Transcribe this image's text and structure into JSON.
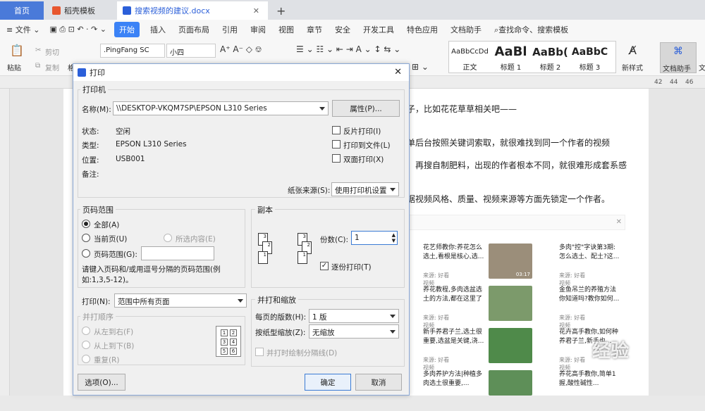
{
  "tabs": {
    "home": "首页",
    "dk": "稻壳模板",
    "doc": "搜索视频的建议.docx",
    "add": "+"
  },
  "menu": {
    "file": "文件",
    "start": "开始",
    "items": [
      "插入",
      "页面布局",
      "引用",
      "审阅",
      "视图",
      "章节",
      "安全",
      "开发工具",
      "特色应用",
      "文档助手"
    ],
    "search": "查找命令、搜索模板"
  },
  "ribbon": {
    "cut": "剪切",
    "copy": "复制",
    "paste": "粘贴",
    "painter": "格",
    "font": ".PingFang SC",
    "size": "小四",
    "styles": [
      {
        "sample": "AaBbCcDd",
        "name": "正文"
      },
      {
        "sample": "AaBl",
        "name": "标题 1"
      },
      {
        "sample": "AaBb(",
        "name": "标题 2"
      },
      {
        "sample": "AaBbC",
        "name": "标题 3"
      }
    ],
    "new_style": "新样式",
    "assistant": "文档助手",
    "wen": "文"
  },
  "ruler": [
    "42",
    "44",
    "46"
  ],
  "doc": {
    "lines": [
      "子，比如花花草草相关吧——",
      "单后台按照关键词索取，就很难找到同一个作者的视频",
      "、再搜自制肥料，出现的作者根本不同，就很难形成套系感",
      "据视频风格、质量、视频来源等方面先锁定一个作者。"
    ],
    "videos": [
      {
        "title": "花艺师教你:养花怎么选土,看根是核心,选...",
        "src": "来源: 好看视频"
      },
      {
        "title": "多肉\"控\"字诀第3期:怎么选土、配土?这...",
        "src": "来源: 好看视频"
      },
      {
        "title": "养花教程,多肉选盆选土的方法,都在这里了",
        "src": "来源: 好看视频"
      },
      {
        "title": "金鱼吊兰的养殖方法你知道吗?教你如何...",
        "src": "来源: 好看视频"
      },
      {
        "title": "新手养君子兰,选土很重要,选盆是关键,浇...",
        "src": "来源: 好看视频"
      },
      {
        "title": "花卉高手教你,如何种养君子兰,新手也...",
        "src": "来源: 好看视频"
      },
      {
        "title": "多肉养护方法|种植多肉选土很重要,...",
        "src": ""
      },
      {
        "title": "养花高手教你,简单1握,酸性碱性...",
        "src": ""
      }
    ],
    "durations": [
      "03:17"
    ],
    "watermark": "经验"
  },
  "dialog": {
    "title": "打印",
    "printer_group": "打印机",
    "name_label": "名称(M):",
    "printer": "\\\\DESKTOP-VKQM7SP\\EPSON L310 Series",
    "props": "属性(P)...",
    "status_label": "状态:",
    "status": "空闲",
    "type_label": "类型:",
    "type": "EPSON L310 Series",
    "where_label": "位置:",
    "where": "USB001",
    "comment_label": "备注:",
    "reverse": "反片打印(I)",
    "tofile": "打印到文件(L)",
    "duplex": "双面打印(X)",
    "source_label": "纸张来源(S):",
    "source": "使用打印机设置",
    "range_group": "页码范围",
    "all": "全部(A)",
    "current": "当前页(U)",
    "selection": "所选内容(E)",
    "pages": "页码范围(G):",
    "hint": "请键入页码和/或用逗号分隔的页码范围(例如:1,3,5-12)。",
    "copies_group": "副本",
    "copies_label": "份数(C):",
    "copies": "1",
    "collate": "逐份打印(T)",
    "print_label": "打印(N):",
    "print_what": "范围中所有页面",
    "order_group": "并打顺序",
    "lr": "从左到右(F)",
    "tb": "从上到下(B)",
    "repeat": "重复(R)",
    "zoom_group": "并打和缩放",
    "per_sheet_label": "每页的版数(H):",
    "per_sheet": "1 版",
    "scale_label": "按纸型缩放(Z):",
    "scale": "无缩放",
    "lines": "并打时绘制分隔线(D)",
    "options": "选项(O)...",
    "ok": "确定",
    "cancel": "取消",
    "grid": [
      "1",
      "2",
      "3",
      "4",
      "5",
      "6"
    ]
  }
}
